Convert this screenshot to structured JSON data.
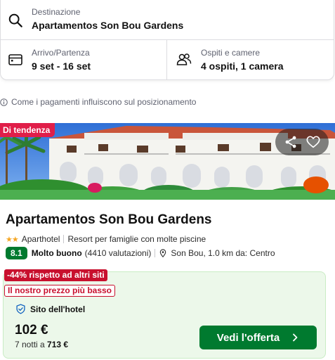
{
  "search": {
    "destination_label": "Destinazione",
    "destination_value": "Apartamentos Son Bou Gardens",
    "dates_label": "Arrivo/Partenza",
    "dates_value": "9 set - 16 set",
    "guests_label": "Ospiti e camere",
    "guests_value": "4 ospiti, 1 camera"
  },
  "info_text": "Come i pagamenti influiscono sul posizionamento",
  "hotel": {
    "badge": "Di tendenza",
    "name": "Apartamentos Son Bou Gardens",
    "stars": 2,
    "type": "Aparthotel",
    "description": "Resort per famiglie con molte piscine",
    "rating": "8.1",
    "rating_text": "Molto buono",
    "reviews": "(4410 valutazioni)",
    "location": "Son Bou, 1.0 km da: Centro"
  },
  "deal": {
    "discount": "-44% rispetto ad altri siti",
    "lowest": "Il nostro prezzo più basso",
    "provider": "Sito dell'hotel",
    "price": "102 €",
    "nights_text": "7 notti a",
    "total": "713 €",
    "cta": "Vedi l'offerta"
  },
  "colors": {
    "primary_green": "#007a2f",
    "trend_red": "#e01e49",
    "deal_bg": "#ecf8ea",
    "star": "#f5a623"
  },
  "icons": [
    "search-icon",
    "calendar-icon",
    "guests-icon",
    "info-icon",
    "share-icon",
    "heart-icon",
    "pin-icon",
    "shield-check-icon",
    "chevron-right-icon"
  ]
}
